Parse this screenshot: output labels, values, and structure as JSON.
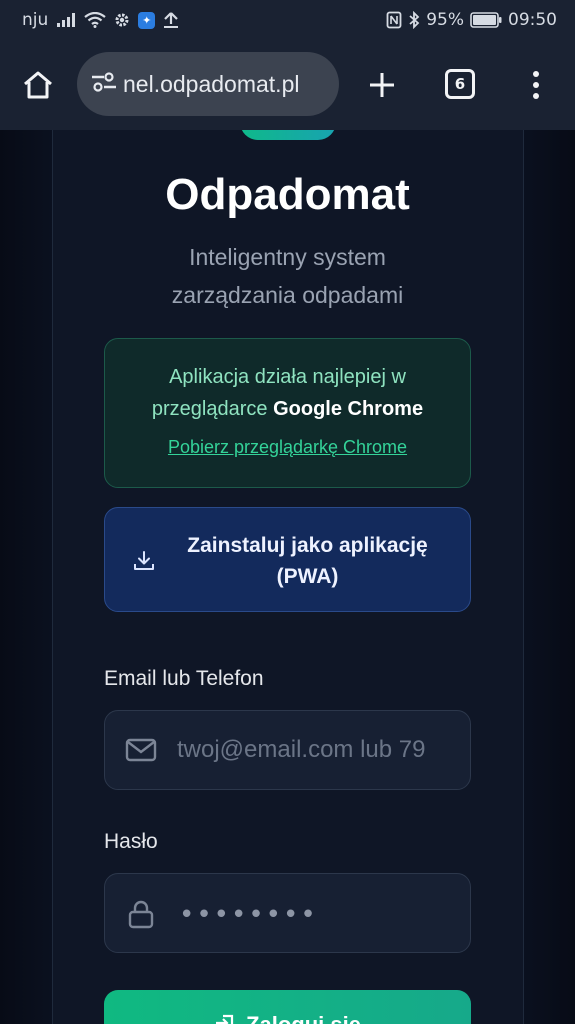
{
  "status_bar": {
    "carrier": "nju",
    "battery_percent": "95%",
    "time": "09:50"
  },
  "browser": {
    "url": "nel.odpadomat.pl",
    "tab_count": "6"
  },
  "page": {
    "title": "Odpadomat",
    "subtitle_line1": "Inteligentny system",
    "subtitle_line2": "zarządzania odpadami",
    "chrome_notice": {
      "line1": "Aplikacja działa najlepiej w",
      "line2_prefix": "przeglądarce ",
      "line2_bold": "Google Chrome",
      "link": "Pobierz przeglądarkę Chrome"
    },
    "pwa_button": {
      "line1": "Zainstaluj jako aplikację",
      "line2": "(PWA)"
    },
    "email_field": {
      "label": "Email lub Telefon",
      "placeholder": "twoj@email.com lub 79"
    },
    "password_field": {
      "label": "Hasło",
      "value_mask": "••••••••"
    },
    "login_button": {
      "label": "Zaloguj się"
    }
  },
  "colors": {
    "accent": "#10b981",
    "pwa_blue": "#132a5c",
    "background": "#0b1120"
  }
}
